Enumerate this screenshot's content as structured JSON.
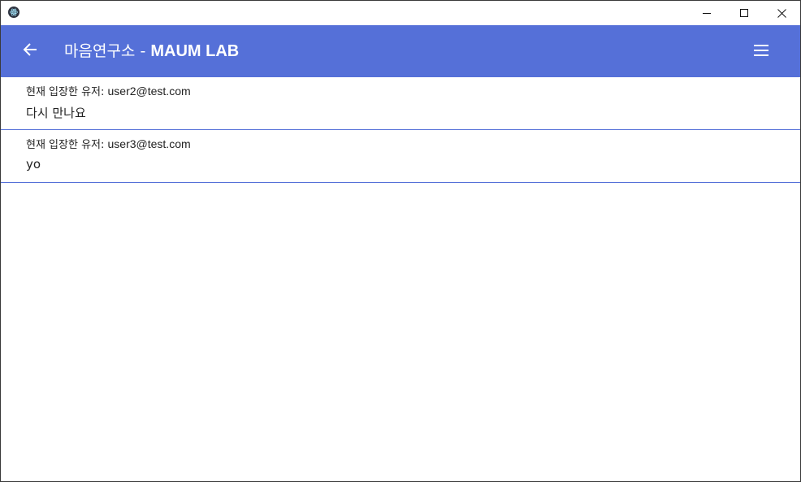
{
  "window": {
    "app_icon": "electron-atom-icon",
    "controls": {
      "minimize_icon": "minimize-icon",
      "maximize_icon": "maximize-icon",
      "close_icon": "close-icon"
    }
  },
  "appbar": {
    "background_color": "#5570d8",
    "back_icon": "arrow-left-icon",
    "title_korean": "마음연구소",
    "title_separator": " - ",
    "title_english": "MAUM LAB",
    "menu_icon": "hamburger-menu-icon"
  },
  "messages": [
    {
      "user_prefix": "현재 입장한 유저: ",
      "user_email": "user2@test.com",
      "text": "다시 만나요"
    },
    {
      "user_prefix": "현재 입장한 유저: ",
      "user_email": "user3@test.com",
      "text": "yo"
    }
  ]
}
